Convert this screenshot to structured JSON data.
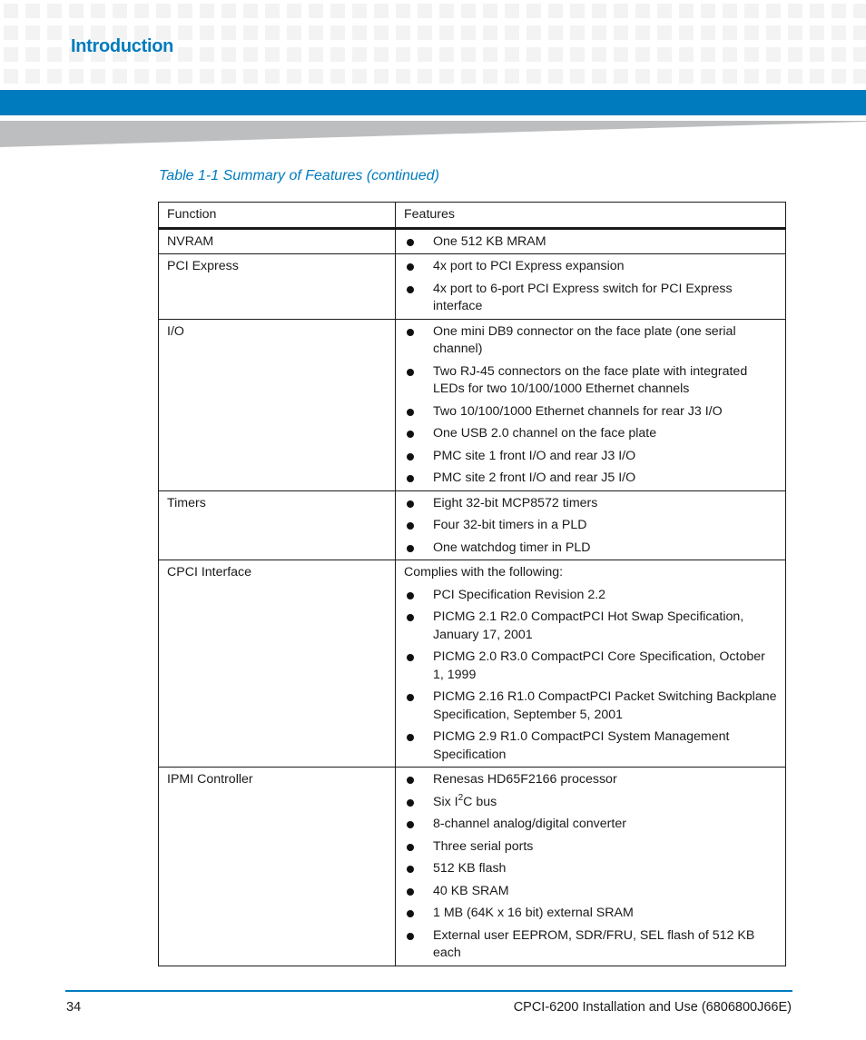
{
  "header": {
    "section_title": "Introduction",
    "accent_color": "#007bbd"
  },
  "caption": "Table 1-1 Summary of Features (continued)",
  "table": {
    "columns": [
      "Function",
      "Features"
    ],
    "rows": [
      {
        "function": "NVRAM",
        "intro": "",
        "items": [
          "One 512 KB MRAM"
        ]
      },
      {
        "function": "PCI Express",
        "intro": "",
        "items": [
          "4x port to PCI Express expansion",
          "4x port to 6-port PCI Express switch for PCI Express interface"
        ]
      },
      {
        "function": "I/O",
        "intro": "",
        "items": [
          "One mini DB9 connector on the face plate (one serial channel)",
          "Two RJ-45 connectors on the face plate with integrated LEDs for two 10/100/1000 Ethernet channels",
          "Two 10/100/1000 Ethernet channels for rear J3 I/O",
          "One USB 2.0 channel on the face plate",
          "PMC site 1 front I/O and rear J3 I/O",
          "PMC site 2 front I/O and rear J5 I/O"
        ]
      },
      {
        "function": "Timers",
        "intro": "",
        "items": [
          "Eight 32-bit MCP8572 timers",
          "Four 32-bit timers in a PLD",
          "One watchdog timer in PLD"
        ]
      },
      {
        "function": "CPCI Interface",
        "intro": "Complies with the following:",
        "items": [
          "PCI Specification Revision 2.2",
          "PICMG 2.1 R2.0 CompactPCI Hot Swap Specification, January 17, 2001",
          "PICMG 2.0 R3.0 CompactPCI Core Specification, October 1, 1999",
          "PICMG 2.16 R1.0 CompactPCI Packet Switching Backplane Specification, September 5, 2001",
          "PICMG 2.9 R1.0 CompactPCI System Management Specification"
        ]
      },
      {
        "function": "IPMI Controller",
        "intro": "",
        "items": [
          "Renesas HD65F2166 processor",
          "Six I²C bus",
          "8-channel analog/digital converter",
          "Three serial ports",
          "512 KB flash",
          "40 KB SRAM",
          "1 MB (64K  x 16 bit) external SRAM",
          "External user EEPROM, SDR/FRU, SEL flash of 512 KB each"
        ]
      }
    ]
  },
  "footer": {
    "page_number": "34",
    "doc_title": "CPCI-6200 Installation and Use (6806800J66E)"
  }
}
